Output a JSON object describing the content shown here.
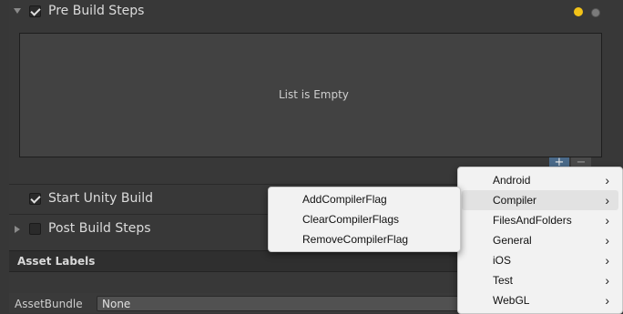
{
  "pre_build": {
    "title": "Pre Build Steps",
    "checked": true,
    "list_empty_text": "List is Empty",
    "add_glyph": "+",
    "remove_glyph": "−"
  },
  "start_unity_build": {
    "label": "Start Unity Build",
    "checked": true
  },
  "post_build": {
    "title": "Post Build Steps",
    "checked": false
  },
  "asset_labels": {
    "header": "Asset Labels",
    "assetbundle_label": "AssetBundle",
    "assetbundle_value": "None"
  },
  "status_colors": {
    "dot": "#f2c218"
  },
  "context_menu": {
    "items": [
      {
        "label": "Android"
      },
      {
        "label": "Compiler",
        "highlighted": true
      },
      {
        "label": "FilesAndFolders"
      },
      {
        "label": "General"
      },
      {
        "label": "iOS"
      },
      {
        "label": "Test"
      },
      {
        "label": "WebGL"
      }
    ],
    "chevron": "›"
  },
  "submenu": {
    "items": [
      {
        "label": "AddCompilerFlag"
      },
      {
        "label": "ClearCompilerFlags"
      },
      {
        "label": "RemoveCompilerFlag"
      }
    ]
  }
}
